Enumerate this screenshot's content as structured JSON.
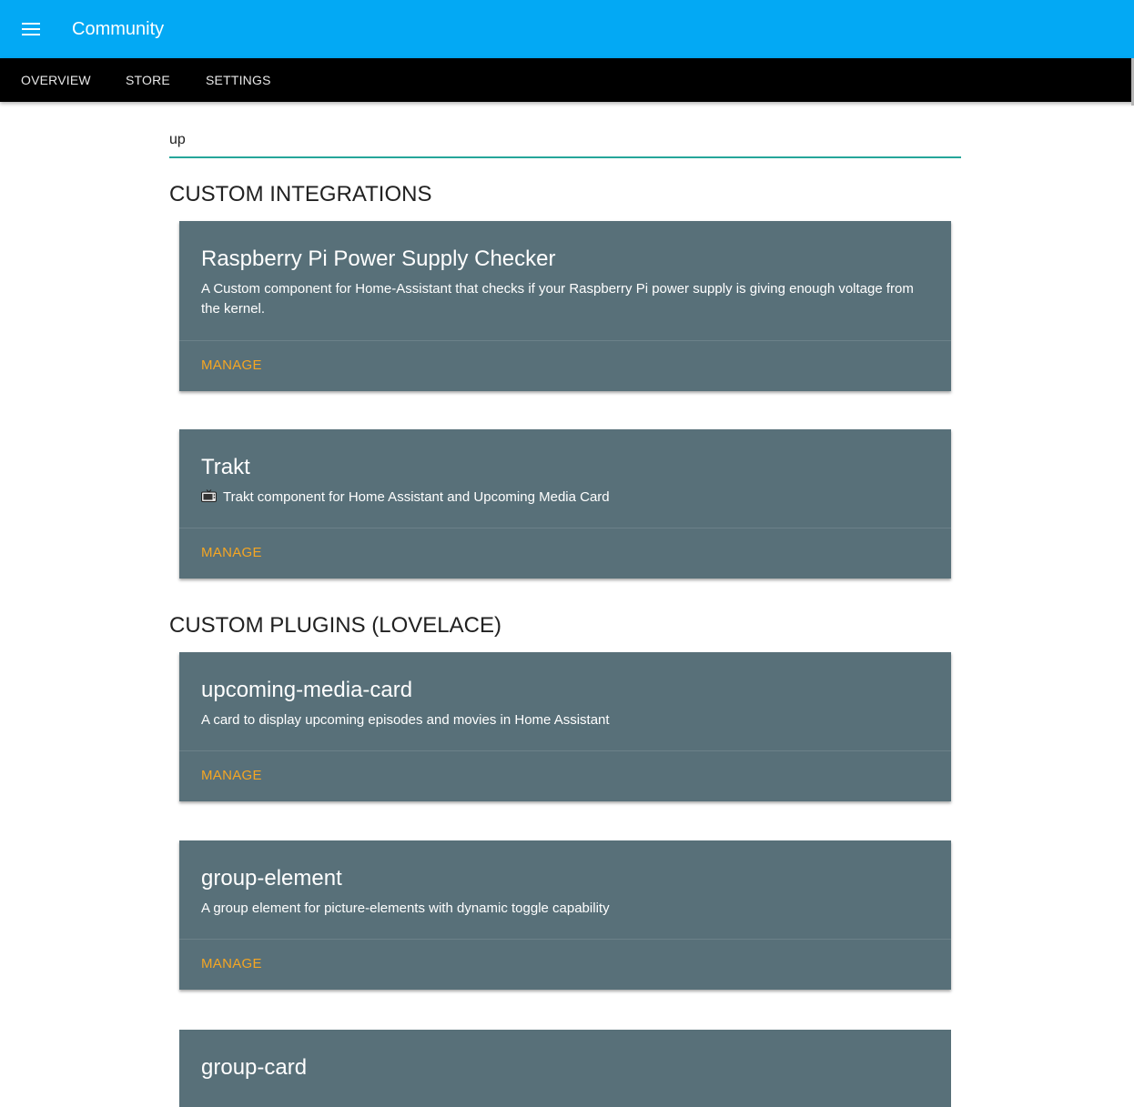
{
  "header": {
    "title": "Community"
  },
  "tabs": [
    {
      "label": "OVERVIEW"
    },
    {
      "label": "STORE"
    },
    {
      "label": "SETTINGS"
    }
  ],
  "search": {
    "value": "up"
  },
  "sections": {
    "integrations": {
      "title": "CUSTOM INTEGRATIONS",
      "cards": [
        {
          "title": "Raspberry Pi Power Supply Checker",
          "description": "A Custom component for Home-Assistant that checks if your Raspberry Pi power supply is giving enough voltage from the kernel.",
          "action": "MANAGE"
        },
        {
          "title": "Trakt",
          "icon": "television-emoji-icon",
          "description": "Trakt component for Home Assistant and Upcoming Media Card",
          "action": "MANAGE"
        }
      ]
    },
    "plugins": {
      "title": "CUSTOM PLUGINS (LOVELACE)",
      "cards": [
        {
          "title": "upcoming-media-card",
          "description": "A card to display upcoming episodes and movies in Home Assistant",
          "action": "MANAGE"
        },
        {
          "title": "group-element",
          "description": "A group element for picture-elements with dynamic toggle capability",
          "action": "MANAGE"
        },
        {
          "title": "group-card"
        }
      ]
    }
  },
  "colors": {
    "header": "#03a9f4",
    "tabbar": "#000000",
    "card": "#587079",
    "action": "#f5a623",
    "search_underline": "#26a69a"
  }
}
